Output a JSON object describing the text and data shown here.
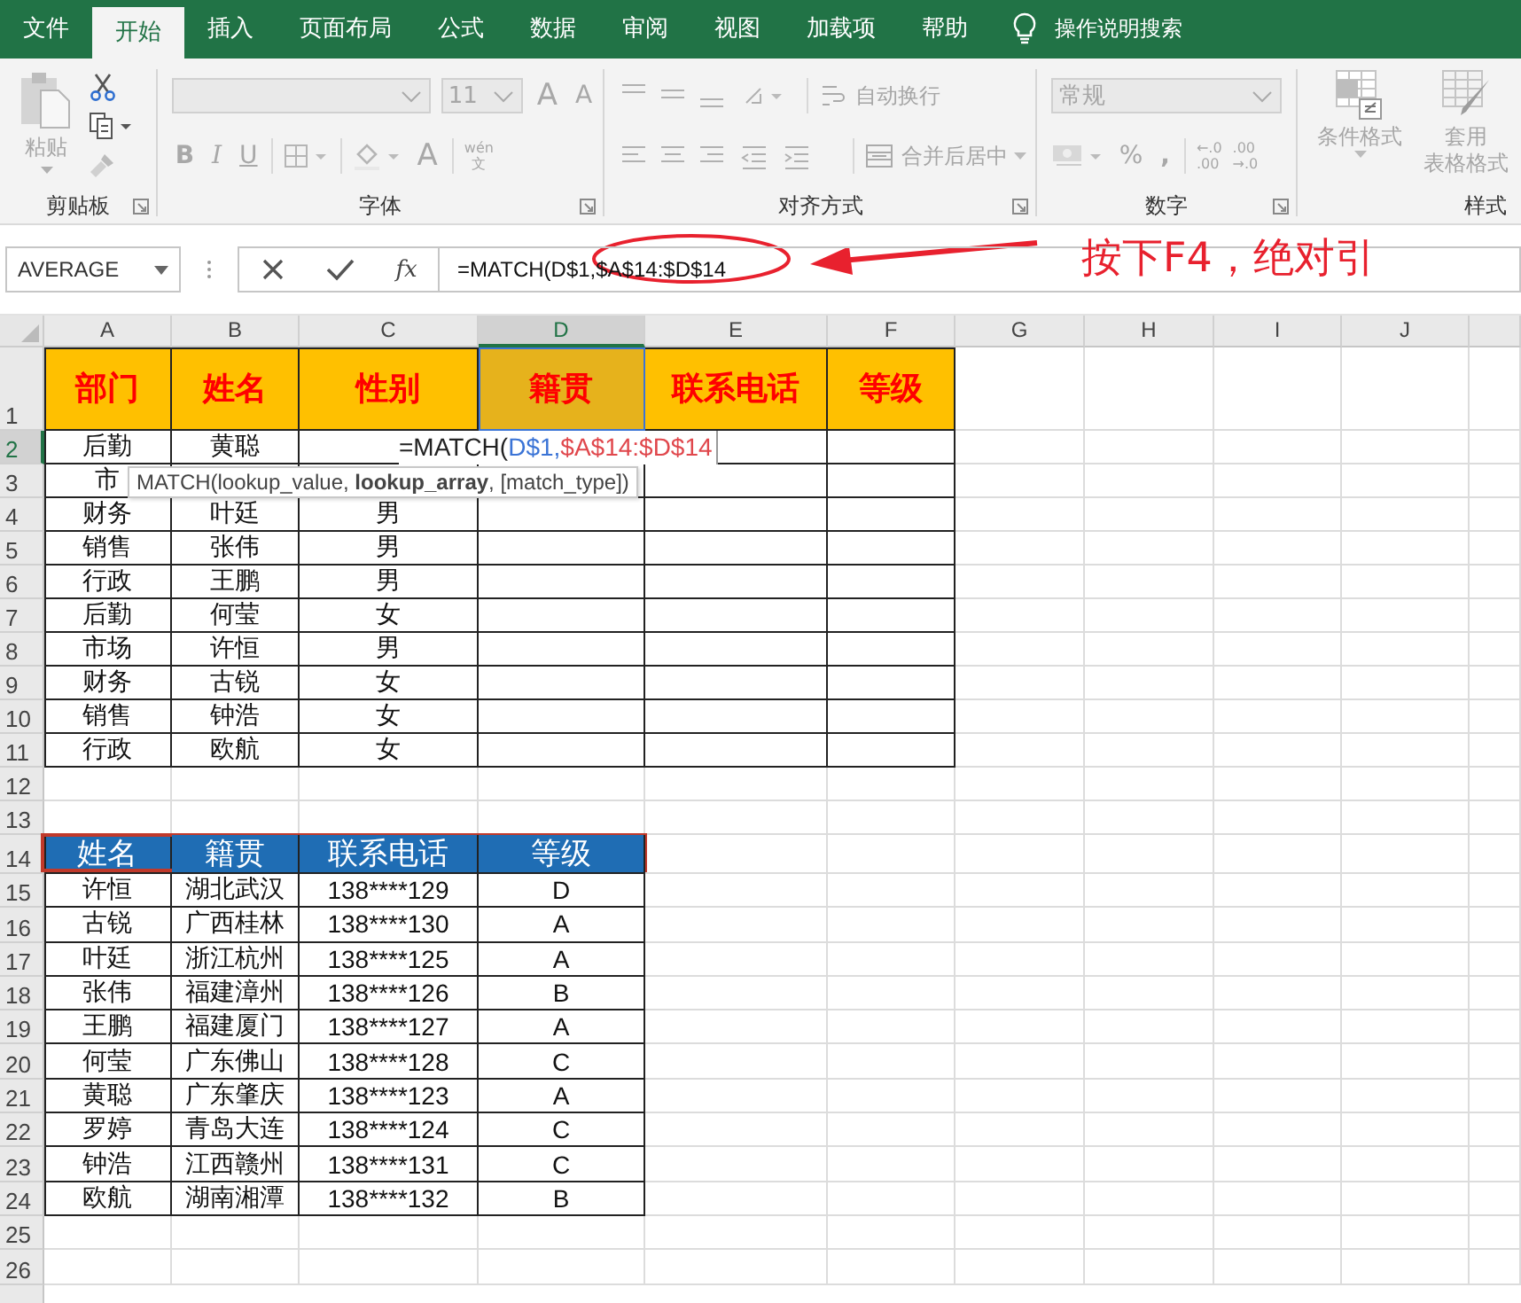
{
  "ribbon_tabs": [
    {
      "label": "文件",
      "selected": false
    },
    {
      "label": "开始",
      "selected": true
    },
    {
      "label": "插入",
      "selected": false
    },
    {
      "label": "页面布局",
      "selected": false
    },
    {
      "label": "公式",
      "selected": false
    },
    {
      "label": "数据",
      "selected": false
    },
    {
      "label": "审阅",
      "selected": false
    },
    {
      "label": "视图",
      "selected": false
    },
    {
      "label": "加载项",
      "selected": false
    },
    {
      "label": "帮助",
      "selected": false
    }
  ],
  "tell_me": "操作说明搜索",
  "ribbon": {
    "clipboard": {
      "paste": "粘贴",
      "group": "剪贴板"
    },
    "font": {
      "size": "11",
      "grow": "A",
      "shrink": "A",
      "bold": "B",
      "italic": "I",
      "underline": "U",
      "font_color": "A",
      "phonetic_top": "wén",
      "phonetic_bottom": "文",
      "group": "字体"
    },
    "alignment": {
      "wrap": "自动换行",
      "merge": "合并后居中",
      "group": "对齐方式"
    },
    "number": {
      "format": "常规",
      "percent": "%",
      "comma": ",",
      "decimals": [
        [
          "←.0",
          ".00"
        ],
        [
          ".00",
          "→.0"
        ]
      ],
      "group": "数字"
    },
    "styles": {
      "conditional": "条件格式",
      "table_format": [
        "套用",
        "表格格式"
      ],
      "group": "样式"
    }
  },
  "formula_bar": {
    "name_box": "AVERAGE",
    "fx": "fx",
    "formula": "=MATCH(D$1,$A$14:$D$14"
  },
  "annotation": "按下F4，绝对引",
  "sheet": {
    "columns": [
      {
        "label": "A",
        "selected": false
      },
      {
        "label": "B",
        "selected": false
      },
      {
        "label": "C",
        "selected": false
      },
      {
        "label": "D",
        "selected": true
      },
      {
        "label": "E",
        "selected": false
      },
      {
        "label": "F",
        "selected": false
      },
      {
        "label": "G",
        "selected": false
      },
      {
        "label": "H",
        "selected": false
      },
      {
        "label": "I",
        "selected": false
      },
      {
        "label": "J",
        "selected": false
      }
    ],
    "rows": [
      {
        "label": "1",
        "selected": false
      },
      {
        "label": "2",
        "selected": true
      },
      {
        "label": "3",
        "selected": false
      },
      {
        "label": "4",
        "selected": false
      },
      {
        "label": "5",
        "selected": false
      },
      {
        "label": "6",
        "selected": false
      },
      {
        "label": "7",
        "selected": false
      },
      {
        "label": "8",
        "selected": false
      },
      {
        "label": "9",
        "selected": false
      },
      {
        "label": "10",
        "selected": false
      },
      {
        "label": "11",
        "selected": false
      },
      {
        "label": "12",
        "selected": false
      },
      {
        "label": "13",
        "selected": false
      },
      {
        "label": "14",
        "selected": false
      },
      {
        "label": "15",
        "selected": false
      },
      {
        "label": "16",
        "selected": false
      },
      {
        "label": "17",
        "selected": false
      },
      {
        "label": "18",
        "selected": false
      },
      {
        "label": "19",
        "selected": false
      },
      {
        "label": "20",
        "selected": false
      },
      {
        "label": "21",
        "selected": false
      },
      {
        "label": "22",
        "selected": false
      },
      {
        "label": "23",
        "selected": false
      },
      {
        "label": "24",
        "selected": false
      },
      {
        "label": "25",
        "selected": false
      },
      {
        "label": "26",
        "selected": false
      }
    ]
  },
  "table1": {
    "header": [
      {
        "text": "部门",
        "selected": false
      },
      {
        "text": "姓名",
        "selected": false
      },
      {
        "text": "性别",
        "selected": false
      },
      {
        "text": "籍贯",
        "selected": true
      },
      {
        "text": "联系电话",
        "selected": false
      },
      {
        "text": "等级",
        "selected": false
      }
    ],
    "rows": [
      [
        "后勤",
        "黄聪"
      ],
      [
        "市"
      ],
      [
        "财务",
        "叶廷",
        "男"
      ],
      [
        "销售",
        "张伟",
        "男"
      ],
      [
        "行政",
        "王鹏",
        "男"
      ],
      [
        "后勤",
        "何莹",
        "女"
      ],
      [
        "市场",
        "许恒",
        "男"
      ],
      [
        "财务",
        "古锐",
        "女"
      ],
      [
        "销售",
        "钟浩",
        "女"
      ],
      [
        "行政",
        "欧航",
        "女"
      ]
    ]
  },
  "editing_cell": {
    "parts": [
      {
        "text": "=MATCH(",
        "color": "#222222"
      },
      {
        "text": "D$1,",
        "color": "#3b74d6"
      },
      {
        "text": "$A$14:$D$14",
        "color": "#e0474c"
      }
    ]
  },
  "tooltip": "MATCH(lookup_value, **lookup_array**, [match_type])",
  "table2": {
    "header": [
      "姓名",
      "籍贯",
      "联系电话",
      "等级"
    ],
    "rows": [
      [
        "许恒",
        "湖北武汉",
        "138****129",
        "D"
      ],
      [
        "古锐",
        "广西桂林",
        "138****130",
        "A"
      ],
      [
        "叶廷",
        "浙江杭州",
        "138****125",
        "A"
      ],
      [
        "张伟",
        "福建漳州",
        "138****126",
        "B"
      ],
      [
        "王鹏",
        "福建厦门",
        "138****127",
        "A"
      ],
      [
        "何莹",
        "广东佛山",
        "138****128",
        "C"
      ],
      [
        "黄聪",
        "广东肇庆",
        "138****123",
        "A"
      ],
      [
        "罗婷",
        "青岛大连",
        "138****124",
        "C"
      ],
      [
        "钟浩",
        "江西赣州",
        "138****131",
        "C"
      ],
      [
        "欧航",
        "湖南湘潭",
        "138****132",
        "B"
      ]
    ]
  }
}
